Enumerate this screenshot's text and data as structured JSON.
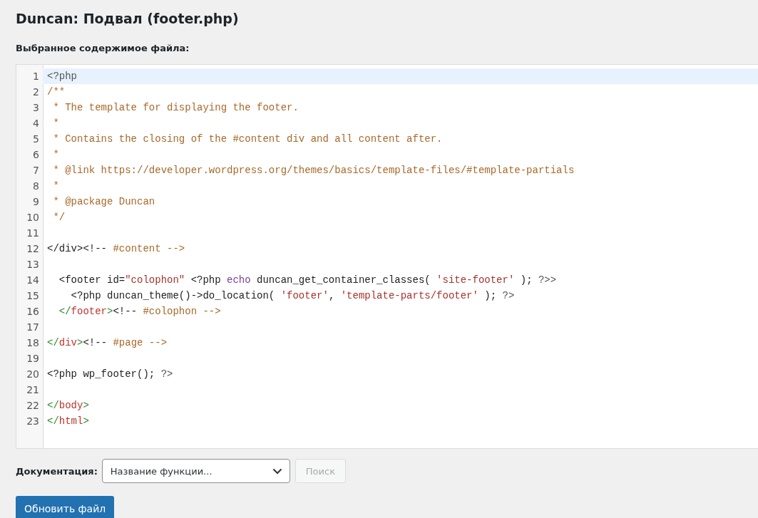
{
  "title": "Duncan: Подвал (footer.php)",
  "editor_label": "Выбранное содержимое файла:",
  "code_lines": [
    {
      "number": "1",
      "active": true,
      "tokens": [
        {
          "kind": "meta",
          "text": "<?php"
        }
      ]
    },
    {
      "number": "2",
      "active": false,
      "tokens": [
        {
          "kind": "comment",
          "text": "/**"
        }
      ]
    },
    {
      "number": "3",
      "active": false,
      "tokens": [
        {
          "kind": "comment",
          "text": " * The template for displaying the footer."
        }
      ]
    },
    {
      "number": "4",
      "active": false,
      "tokens": [
        {
          "kind": "comment",
          "text": " *"
        }
      ]
    },
    {
      "number": "5",
      "active": false,
      "tokens": [
        {
          "kind": "comment",
          "text": " * Contains the closing of the #content div and all content after."
        }
      ]
    },
    {
      "number": "6",
      "active": false,
      "tokens": [
        {
          "kind": "comment",
          "text": " *"
        }
      ]
    },
    {
      "number": "7",
      "active": false,
      "tokens": [
        {
          "kind": "comment",
          "text": " * @link https://developer.wordpress.org/themes/basics/template-files/#template-partials"
        }
      ]
    },
    {
      "number": "8",
      "active": false,
      "tokens": [
        {
          "kind": "comment",
          "text": " *"
        }
      ]
    },
    {
      "number": "9",
      "active": false,
      "tokens": [
        {
          "kind": "comment",
          "text": " * @package Duncan"
        }
      ]
    },
    {
      "number": "10",
      "active": false,
      "tokens": [
        {
          "kind": "comment",
          "text": " */"
        }
      ]
    },
    {
      "number": "11",
      "active": false
    },
    {
      "number": "12",
      "active": false,
      "tokens": [
        {
          "kind": "plain",
          "text": "</div><!-- "
        },
        {
          "kind": "comment",
          "text": "#content -->"
        }
      ]
    },
    {
      "number": "13",
      "active": false
    },
    {
      "number": "14",
      "active": false,
      "tokens": [
        {
          "kind": "plain",
          "text": "  <footer id="
        },
        {
          "kind": "string",
          "text": "\"colophon\""
        },
        {
          "kind": "plain",
          "text": " <?php "
        },
        {
          "kind": "keyword",
          "text": "echo"
        },
        {
          "kind": "plain",
          "text": " duncan_get_container_classes( "
        },
        {
          "kind": "string",
          "text": "'site-footer'"
        },
        {
          "kind": "plain",
          "text": " ); "
        },
        {
          "kind": "meta",
          "text": "?>>"
        }
      ]
    },
    {
      "number": "15",
      "active": false,
      "tokens": [
        {
          "kind": "plain",
          "text": "    <?php duncan_theme()->do_location( "
        },
        {
          "kind": "string",
          "text": "'footer'"
        },
        {
          "kind": "plain",
          "text": ", "
        },
        {
          "kind": "string",
          "text": "'template-parts/footer'"
        },
        {
          "kind": "plain",
          "text": " ); "
        },
        {
          "kind": "meta",
          "text": "?>"
        }
      ]
    },
    {
      "number": "16",
      "active": false,
      "tokens": [
        {
          "kind": "bracket",
          "text": "  </"
        },
        {
          "kind": "tag",
          "text": "footer"
        },
        {
          "kind": "bracket",
          "text": ">"
        },
        {
          "kind": "plain",
          "text": "<!-- "
        },
        {
          "kind": "comment",
          "text": "#colophon -->"
        }
      ]
    },
    {
      "number": "17",
      "active": false
    },
    {
      "number": "18",
      "active": false,
      "tokens": [
        {
          "kind": "bracket",
          "text": "</"
        },
        {
          "kind": "tag",
          "text": "div"
        },
        {
          "kind": "bracket",
          "text": ">"
        },
        {
          "kind": "plain",
          "text": "<!-- "
        },
        {
          "kind": "comment",
          "text": "#page -->"
        }
      ]
    },
    {
      "number": "19",
      "active": false
    },
    {
      "number": "20",
      "active": false,
      "tokens": [
        {
          "kind": "plain",
          "text": "<?php wp_footer(); "
        },
        {
          "kind": "meta",
          "text": "?>"
        }
      ]
    },
    {
      "number": "21",
      "active": false
    },
    {
      "number": "22",
      "active": false,
      "tokens": [
        {
          "kind": "bracket",
          "text": "</"
        },
        {
          "kind": "tag",
          "text": "body"
        },
        {
          "kind": "bracket",
          "text": ">"
        }
      ]
    },
    {
      "number": "23",
      "active": false,
      "tokens": [
        {
          "kind": "bracket",
          "text": "</"
        },
        {
          "kind": "tag",
          "text": "html"
        },
        {
          "kind": "bracket",
          "text": ">"
        }
      ]
    }
  ],
  "documentation": {
    "label": "Документация:",
    "placeholder": "Название функции...",
    "search_button": {
      "label": "Поиск",
      "disabled": true
    }
  },
  "update_button": "Обновить файл"
}
